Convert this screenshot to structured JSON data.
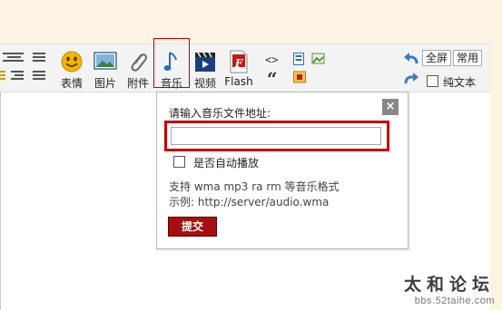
{
  "toolbar": {
    "emoticon_label": "表情",
    "image_label": "图片",
    "attach_label": "附件",
    "music_label": "音乐",
    "video_label": "视频",
    "flash_label": "Flash",
    "quote_glyph": "“",
    "code_glyph": "<>",
    "fullscreen_label": "全屏",
    "common_label": "常用",
    "plaintext_label": "纯文本",
    "flash_badge": "F"
  },
  "music_dialog": {
    "prompt": "请输入音乐文件地址:",
    "url_value": "",
    "url_placeholder": "",
    "autoplay_label": "是否自动播放",
    "support_text": "支持  wma mp3 ra rm 等音乐格式",
    "example_text": "示例: http://server/audio.wma",
    "submit_label": "提交",
    "close_glyph": "×"
  },
  "watermark": {
    "title": "太和论坛",
    "subtitle": "bbs.52taihe.com"
  },
  "colors": {
    "highlight_red": "#c00000",
    "submit_bg": "#a50f0f",
    "page_bg": "#fdf4e3"
  }
}
